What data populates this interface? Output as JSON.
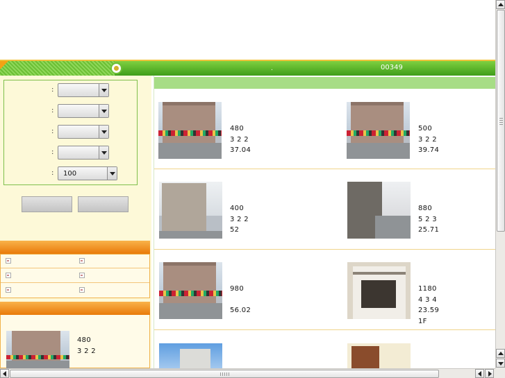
{
  "banner": {
    "separator": ".",
    "code": "00349"
  },
  "search": {
    "fields": [
      {
        "label": ":",
        "value": ""
      },
      {
        "label": ":",
        "value": ""
      },
      {
        "label": ":",
        "value": ""
      },
      {
        "label": ":",
        "value": ""
      },
      {
        "label": ":",
        "value": "100"
      }
    ],
    "buttons": [
      "",
      ""
    ]
  },
  "featured": {
    "line1": "480",
    "line2": "3 2 2"
  },
  "listings": [
    {
      "price": "480",
      "layout": "3 2 2",
      "area": "37.04",
      "floor": "",
      "photo": "street"
    },
    {
      "price": "500",
      "layout": "3 2 2",
      "area": "39.74",
      "floor": "",
      "photo": "street"
    },
    {
      "price": "400",
      "layout": "3 2 2",
      "area": "52",
      "floor": "",
      "photo": "tower"
    },
    {
      "price": "880",
      "layout": "5 2 3",
      "area": "25.71",
      "floor": "",
      "photo": "alley"
    },
    {
      "price": "980",
      "layout": "",
      "area": "56.02",
      "floor": "",
      "photo": "street"
    },
    {
      "price": "1180",
      "layout": "4 3 4",
      "area": "23.59",
      "floor": "1F",
      "photo": "interior"
    },
    {
      "price": "",
      "layout": "",
      "area": "",
      "floor": "",
      "photo": "sky"
    },
    {
      "price": "",
      "layout": "",
      "area": "",
      "floor": "",
      "photo": "room"
    }
  ],
  "colors": {
    "accent_green": "#3e9d1a",
    "accent_orange": "#e97a09",
    "sidebar_bg": "#fdf9d8"
  },
  "icons": [
    "knob-icon",
    "link-bullet-icon",
    "scroll-arrow-icon"
  ]
}
